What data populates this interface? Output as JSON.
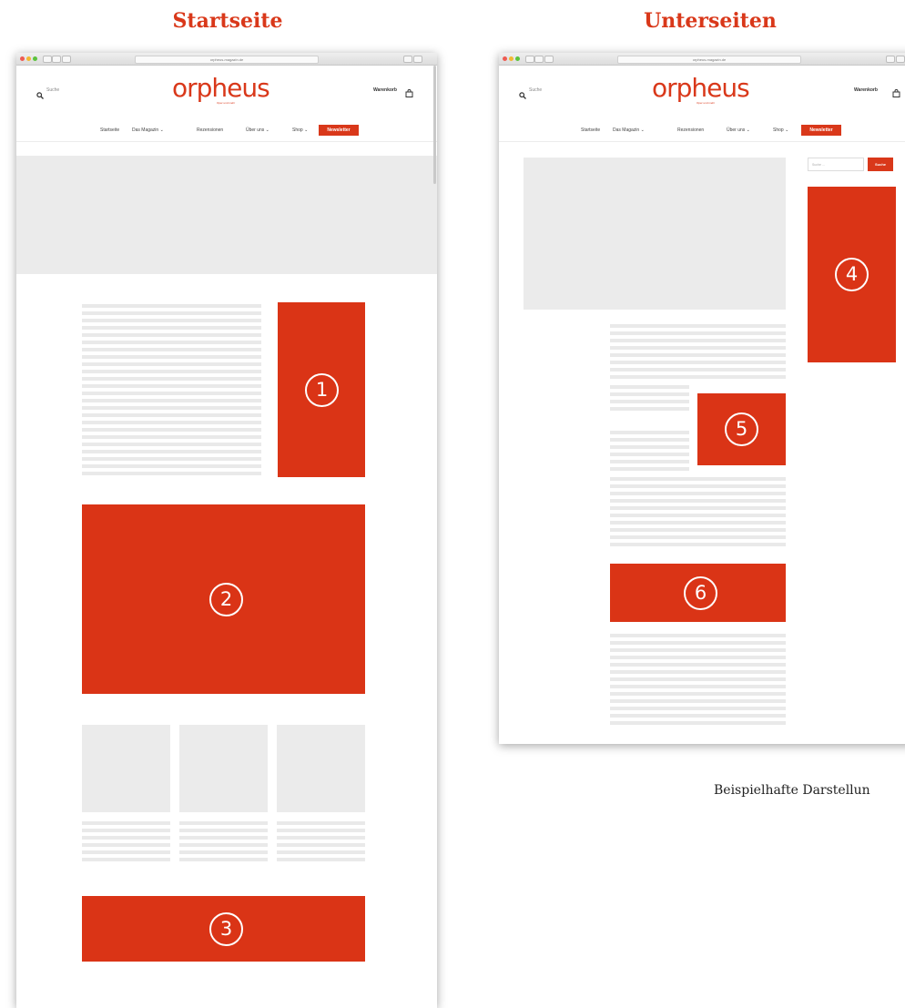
{
  "headings": {
    "left": "Startseite",
    "right": "Unterseiten"
  },
  "colors": {
    "accent": "#da3416",
    "placeholder": "#ebebeb"
  },
  "browser": {
    "url": "orpheus-magazin.de"
  },
  "site": {
    "search_label": "Suche",
    "logo": "orpheus",
    "tagline": "Oper und mehr",
    "cart_label": "Warenkorb",
    "nav": [
      "Startseite",
      "Das Magazin ⌄",
      "Rezensionen",
      "Über uns ⌄",
      "Shop ⌄"
    ],
    "newsletter_label": "Newsletter",
    "sidebar_search_placeholder": "Suche ...",
    "sidebar_search_button": "Suche"
  },
  "markers": [
    "1",
    "2",
    "3",
    "4",
    "5",
    "6"
  ],
  "caption": "Beispielhafte Darstellun"
}
